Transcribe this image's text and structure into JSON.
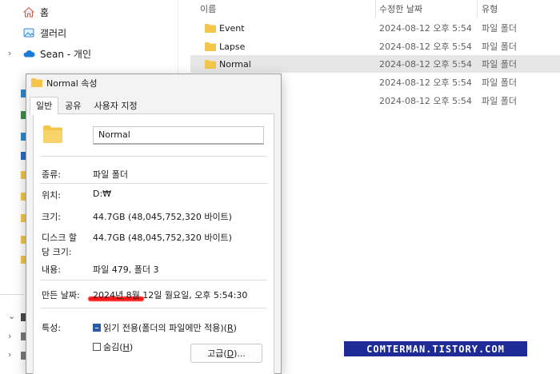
{
  "nav": {
    "items": [
      {
        "label": "홈",
        "icon": "home-icon"
      },
      {
        "label": "갤러리",
        "icon": "gallery-icon"
      },
      {
        "label": "Sean - 개인",
        "icon": "cloud-icon"
      }
    ]
  },
  "list": {
    "columns": [
      "이름",
      "수정한 날짜",
      "유형"
    ],
    "rows": [
      {
        "name": "Event",
        "date": "2024-08-12 오후 5:54",
        "type": "파일 폴더"
      },
      {
        "name": "Lapse",
        "date": "2024-08-12 오후 5:54",
        "type": "파일 폴더"
      },
      {
        "name": "Normal",
        "date": "2024-08-12 오후 5:54",
        "type": "파일 폴더",
        "selected": true
      },
      {
        "name": "",
        "date": "2024-08-12 오후 5:54",
        "type": "파일 폴더"
      },
      {
        "name": "",
        "date": "2024-08-12 오후 5:54",
        "type": "파일 폴더"
      }
    ]
  },
  "dialog": {
    "title": "Normal 속성",
    "tabs": [
      "일반",
      "공유",
      "사용자 지정"
    ],
    "folder_name": "Normal",
    "fields": {
      "type_label": "종류:",
      "type_value": "파일 폴더",
      "location_label": "위치:",
      "location_value": "D:₩",
      "size_label": "크기:",
      "size_value": "44.7GB (48,045,752,320 바이트)",
      "disk_size_label_1": "디스크 할",
      "disk_size_label_2": "당 크기:",
      "disk_size_value": "44.7GB (48,045,752,320 바이트)",
      "contents_label": "내용:",
      "contents_value": "파일 479, 폴더 3",
      "created_label": "만든 날짜:",
      "created_value": "2024년 8월 12일 월요일, 오후 5:54:30",
      "attributes_label": "특성:"
    },
    "readonly_text": "읽기 전용(폴더의 파일에만 적용)",
    "readonly_key": "R",
    "hidden_text": "숨김",
    "hidden_key": "H",
    "advanced_text": "고급",
    "advanced_key": "D",
    "advanced_suffix": "..."
  },
  "watermark": "COMTERMAN.TISTORY.COM",
  "colors": {
    "folder": "#f3c54a",
    "selection": "#e6e6e6",
    "watermark_bg": "#1e2a96",
    "highlight": "#ff1a1a",
    "accent": "#2b5aa8"
  }
}
